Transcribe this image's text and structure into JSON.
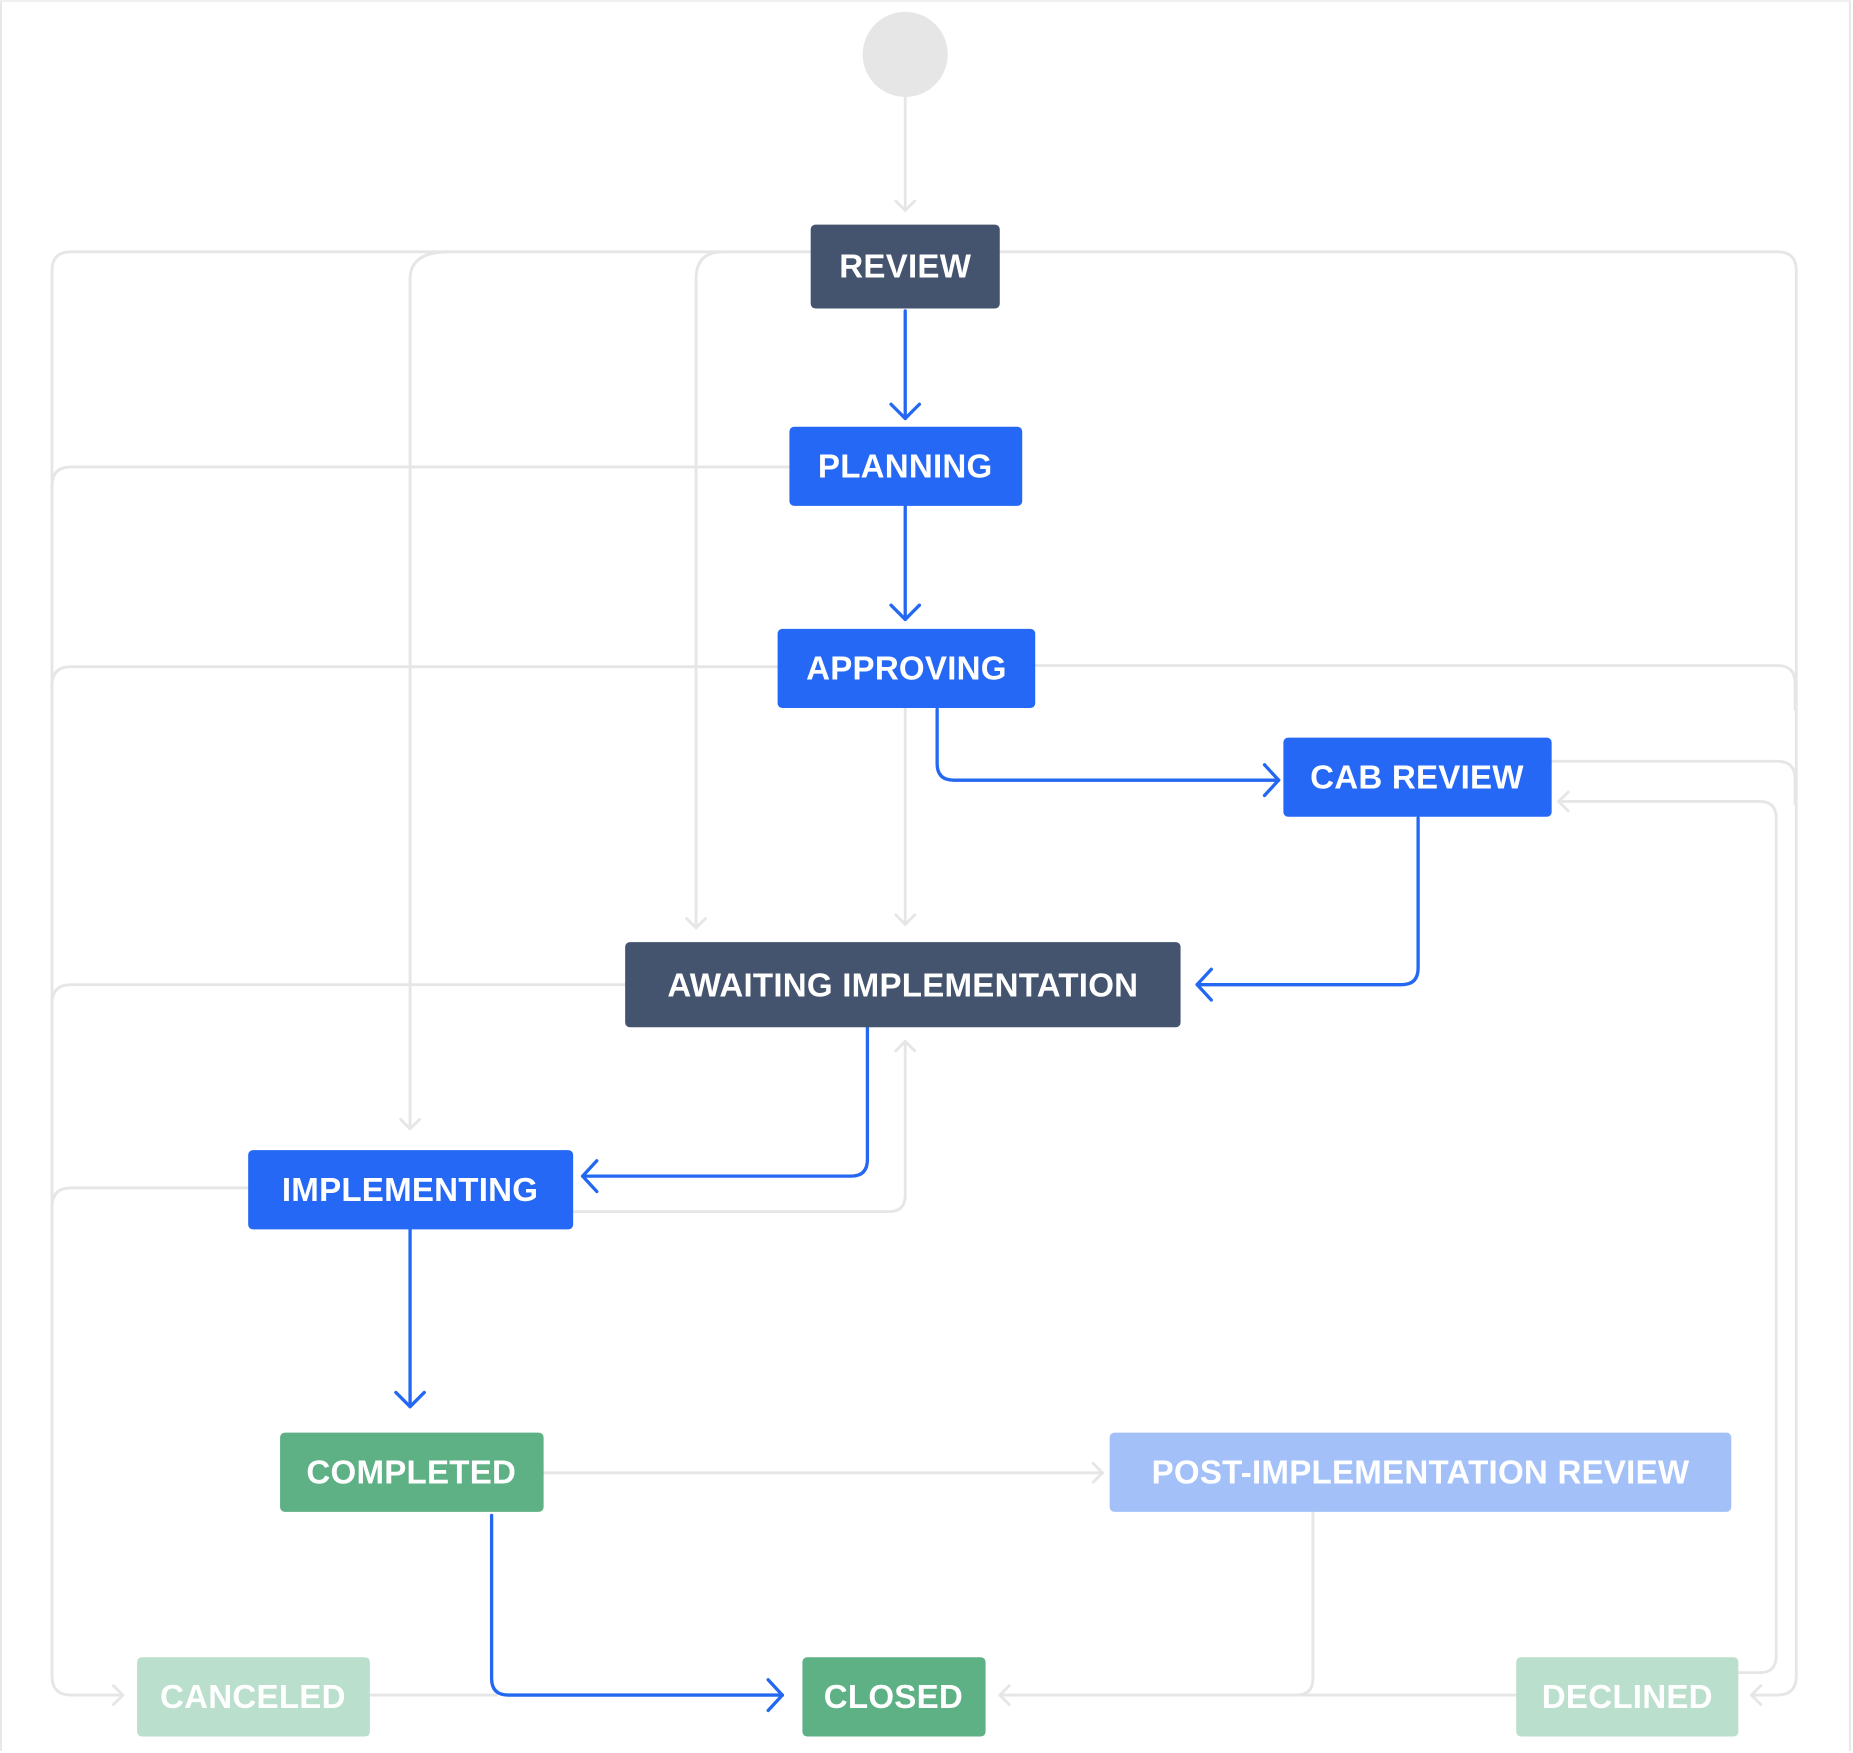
{
  "diagram": {
    "type": "workflow",
    "colors": {
      "status_dark": "#44536e",
      "status_blue": "#2568f5",
      "status_blue_faded": "#a3c1f8",
      "status_green": "#5eb185",
      "status_green_faded": "#badfcc",
      "edge_active": "#2468f2",
      "edge_muted": "#e6e6e6",
      "start": "#e6e6e6"
    },
    "statuses": {
      "review": "REVIEW",
      "planning": "PLANNING",
      "approving": "APPROVING",
      "cab_review": "CAB REVIEW",
      "awaiting_implementation": "AWAITING IMPLEMENTATION",
      "implementing": "IMPLEMENTING",
      "completed": "COMPLETED",
      "post_implementation_review": "POST-IMPLEMENTATION REVIEW",
      "canceled": "CANCELED",
      "closed": "CLOSED",
      "declined": "DECLINED"
    },
    "transitions": [
      {
        "from": "start",
        "to": "review",
        "highlighted": false
      },
      {
        "from": "review",
        "to": "planning",
        "highlighted": true
      },
      {
        "from": "planning",
        "to": "approving",
        "highlighted": true
      },
      {
        "from": "approving",
        "to": "cab_review",
        "highlighted": true
      },
      {
        "from": "cab_review",
        "to": "awaiting_implementation",
        "highlighted": true
      },
      {
        "from": "awaiting_implementation",
        "to": "implementing",
        "highlighted": true
      },
      {
        "from": "implementing",
        "to": "completed",
        "highlighted": true
      },
      {
        "from": "completed",
        "to": "closed",
        "highlighted": true
      },
      {
        "from": "review",
        "to": "awaiting_implementation",
        "highlighted": false
      },
      {
        "from": "review",
        "to": "implementing",
        "highlighted": false
      },
      {
        "from": "approving",
        "to": "awaiting_implementation",
        "highlighted": false
      },
      {
        "from": "implementing",
        "to": "awaiting_implementation",
        "highlighted": false
      },
      {
        "from": "completed",
        "to": "post_implementation_review",
        "highlighted": false
      },
      {
        "from": "post_implementation_review",
        "to": "closed",
        "highlighted": false
      },
      {
        "from": "declined",
        "to": "cab_review",
        "highlighted": false
      },
      {
        "from": "review",
        "to": "declined",
        "highlighted": false
      },
      {
        "from": "approving",
        "to": "declined",
        "highlighted": false
      },
      {
        "from": "cab_review",
        "to": "declined",
        "highlighted": false
      },
      {
        "from": "review",
        "to": "canceled",
        "highlighted": false
      },
      {
        "from": "planning",
        "to": "canceled",
        "highlighted": false
      },
      {
        "from": "approving",
        "to": "canceled",
        "highlighted": false
      },
      {
        "from": "awaiting_implementation",
        "to": "canceled",
        "highlighted": false
      },
      {
        "from": "implementing",
        "to": "canceled",
        "highlighted": false
      },
      {
        "from": "canceled",
        "to": "closed",
        "highlighted": false
      },
      {
        "from": "declined",
        "to": "closed",
        "highlighted": false
      }
    ]
  }
}
